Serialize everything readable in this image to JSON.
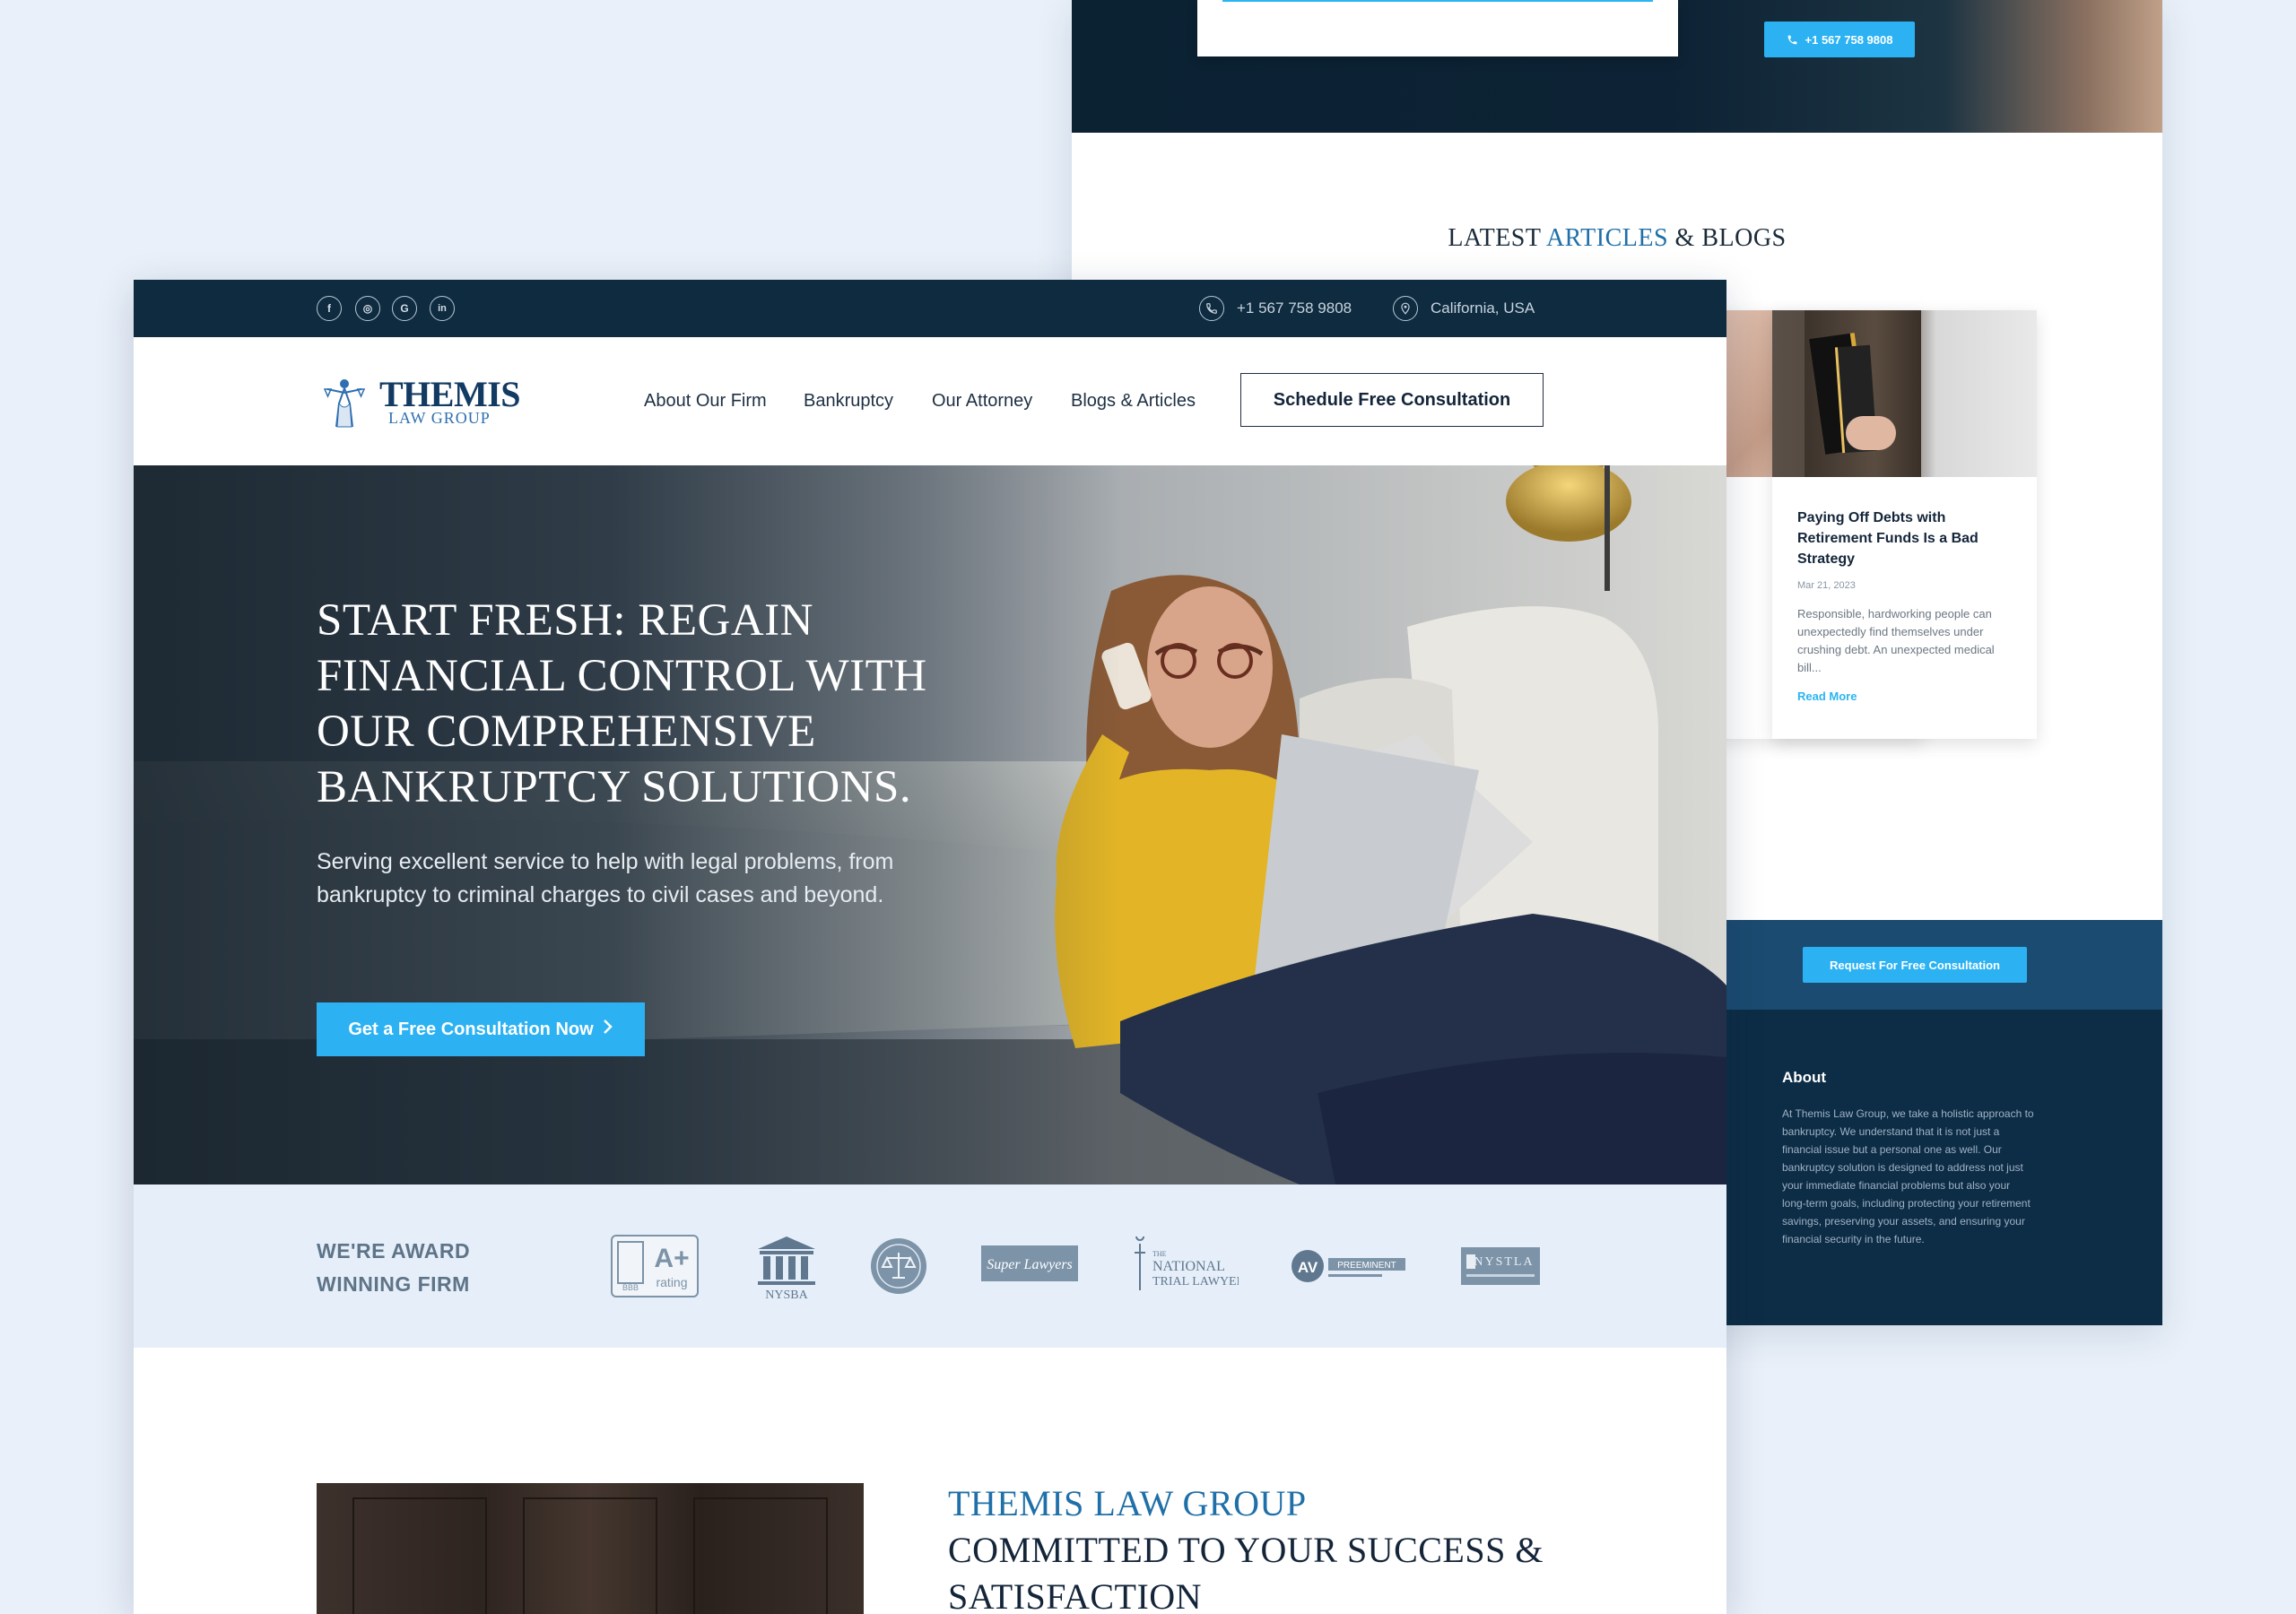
{
  "back_page": {
    "phone_button": "+1 567 758 9808",
    "articles": {
      "title_prefix": "LATEST ",
      "title_accent": "ARTICLES",
      "title_suffix": " & BLOGS",
      "card": {
        "title": "Paying Off Debts with Retirement Funds Is a Bad Strategy",
        "date": "Mar 21, 2023",
        "excerpt": "Responsible, hardworking people can unexpectedly find themselves under crushing debt. An unexpected medical bill...",
        "read_more": "Read More"
      }
    },
    "cta_button": "Request For Free Consultation",
    "footer": {
      "about_heading": "About",
      "about_text": "At Themis Law Group, we take a holistic approach to bankruptcy. We understand that it is not just a financial issue but a personal one as well. Our bankruptcy solution is designed to address not just your immediate financial problems but also your long-term goals, including protecting your retirement savings, preserving your assets, and ensuring your financial security in the future."
    }
  },
  "topbar": {
    "socials": [
      {
        "icon": "facebook-icon",
        "glyph": "f"
      },
      {
        "icon": "instagram-icon",
        "glyph": "◎"
      },
      {
        "icon": "google-icon",
        "glyph": "G"
      },
      {
        "icon": "linkedin-icon",
        "glyph": "in"
      }
    ],
    "phone": "+1 567 758 9808",
    "location": "California, USA"
  },
  "nav": {
    "logo_main": "THEMIS",
    "logo_sub": "LAW GROUP",
    "links": [
      "About Our Firm",
      "Bankruptcy",
      "Our Attorney",
      "Blogs & Articles"
    ],
    "cta": "Schedule Free Consultation"
  },
  "hero": {
    "title": "START FRESH: REGAIN FINANCIAL CONTROL WITH OUR COMPREHENSIVE BANKRUPTCY SOLUTIONS.",
    "subtitle": "Serving excellent service to help with legal problems, from bankruptcy to criminal charges to civil cases and beyond.",
    "button": "Get a Free Consultation Now"
  },
  "awards": {
    "label": "WE'RE AWARD WINNING FIRM",
    "bbb_letters": "BBB",
    "bbb_grade": "A+",
    "bbb_rating": "rating",
    "nysba": "NYSBA",
    "superlawyers": "Super Lawyers",
    "ntl_top": "THE",
    "ntl_mid": "NATIONAL",
    "ntl_bottom": "TRIAL LAWYERS",
    "av": "AV",
    "av_text": "PREEMINENT",
    "nystla": "NYSTLA"
  },
  "about": {
    "kicker": "THEMIS LAW GROUP",
    "heading": "COMMITTED TO YOUR SUCCESS & SATISFACTION"
  },
  "colors": {
    "navy": "#0e2b40",
    "accent_blue": "#2cb2f2",
    "title_blue": "#1f6fa8"
  }
}
